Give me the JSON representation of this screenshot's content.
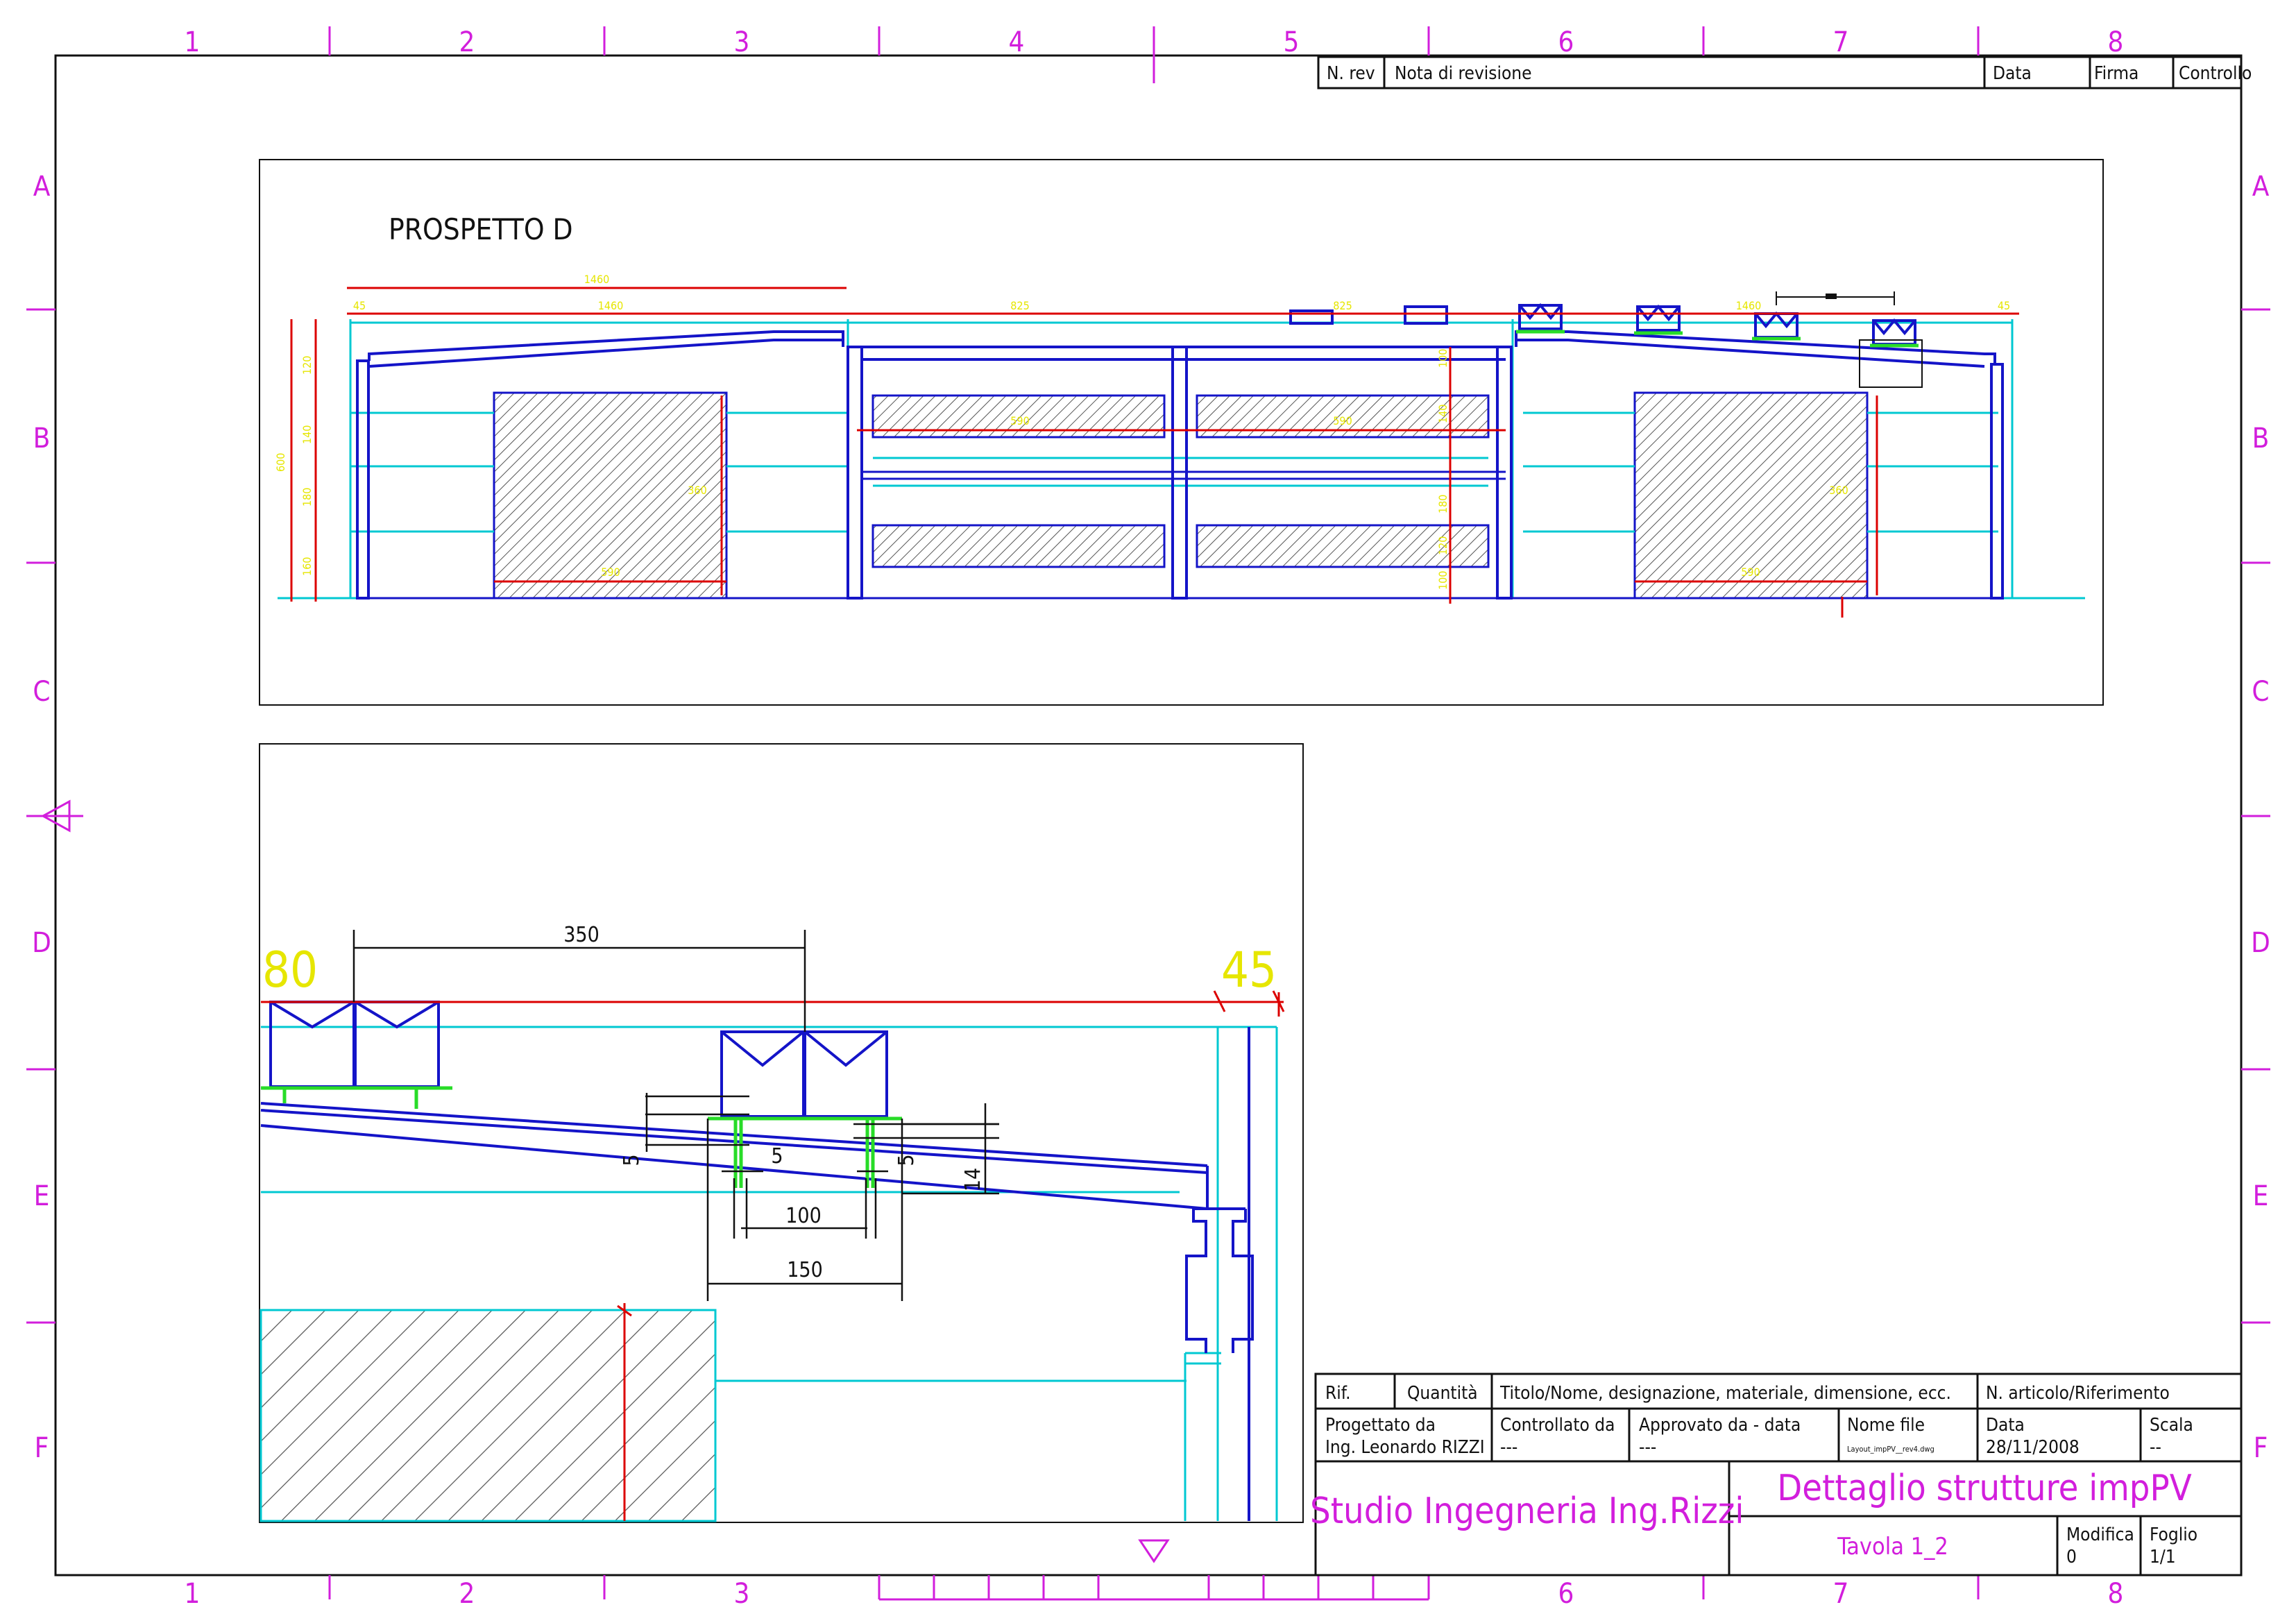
{
  "drawing": {
    "view_title": "PROSPETTO D",
    "elevation_dims": {
      "spans_top": [
        "1460",
        "1460",
        "825",
        "825",
        "1460"
      ],
      "small_top": [
        "45",
        "45"
      ],
      "heights": [
        "600",
        "120",
        "140",
        "180",
        "160"
      ],
      "openings": [
        "590",
        "360",
        "590",
        "590",
        "590",
        "360"
      ],
      "right_heights": [
        "100",
        "140",
        "180",
        "120",
        "100"
      ]
    },
    "detail_dims": {
      "d350": "350",
      "d80": "80",
      "d45": "45",
      "d5a": "5",
      "d5b": "5",
      "d5c": "5",
      "d14": "14",
      "d100": "100",
      "d150": "150"
    }
  },
  "grid": {
    "columns": [
      "1",
      "2",
      "3",
      "4",
      "5",
      "6",
      "7",
      "8"
    ],
    "rows": [
      "A",
      "B",
      "C",
      "D",
      "E",
      "F"
    ]
  },
  "revision_table": {
    "headers": [
      "N. rev",
      "Nota di revisione",
      "Data",
      "Firma",
      "Controllo"
    ]
  },
  "title_block": {
    "h_rif": "Rif.",
    "h_qty": "Quantità",
    "h_title": "Titolo/Nome, designazione, materiale, dimensione, ecc.",
    "h_article": "N. articolo/Riferimento",
    "designed_label": "Progettato da",
    "designed_value": "Ing. Leonardo RIZZI",
    "checked_label": "Controllato da",
    "checked_value": "---",
    "approved_label": "Approvato da - data",
    "approved_value": "---",
    "file_label": "Nome file",
    "file_value": "Layout_impPV__rev4.dwg",
    "date_label": "Data",
    "date_value": "28/11/2008",
    "scale_label": "Scala",
    "scale_value": "--",
    "studio": "Studio Ingegneria Ing.Rizzi",
    "drawing_title": "Dettaglio strutture impPV",
    "sheet": "Tavola 1_2",
    "mod_label": "Modifica",
    "mod_value": "0",
    "foglio_label": "Foglio",
    "foglio_value": "1/1"
  },
  "colors": {
    "frame": "#d21edc",
    "structure": "#1414c8",
    "cyan": "#00c8d2",
    "dim_red": "#dc0000",
    "dim_yellow": "#e6e600",
    "support_green": "#28dc28",
    "hatch": "#555555"
  }
}
